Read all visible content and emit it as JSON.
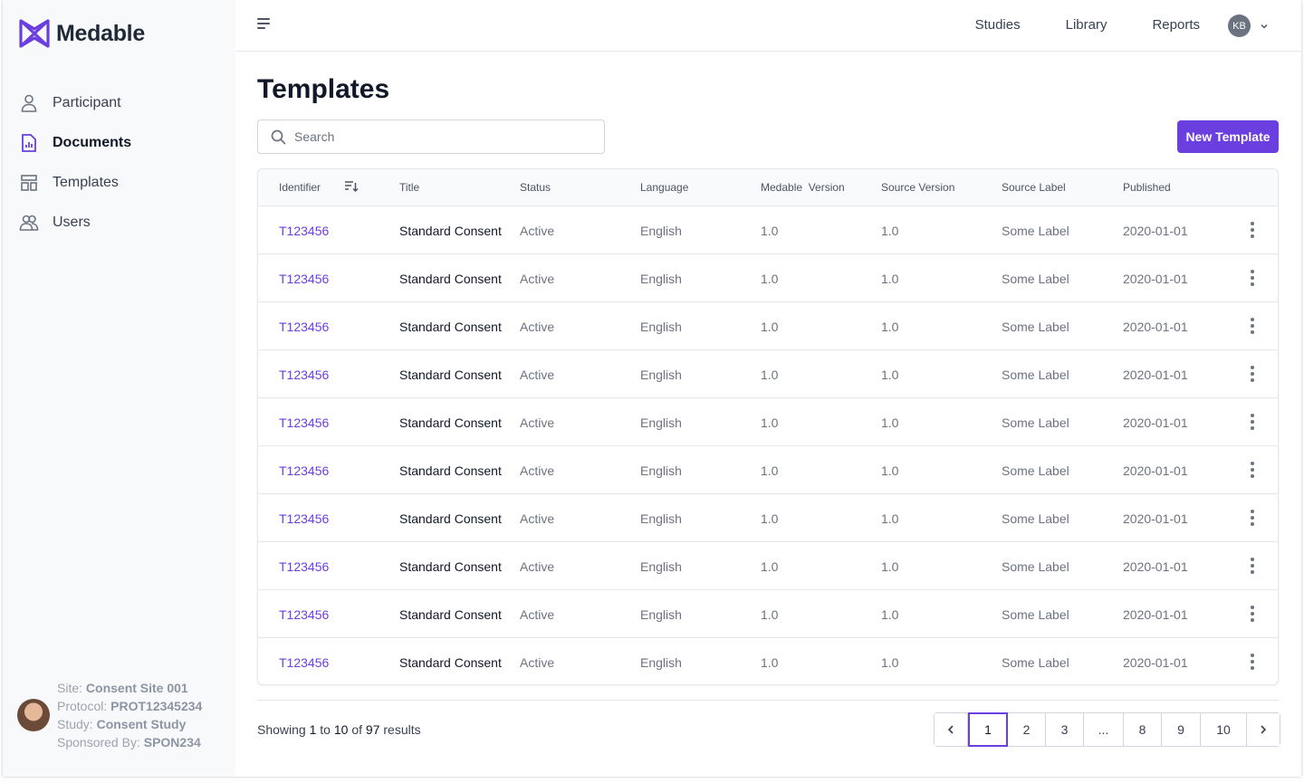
{
  "brand": {
    "name": "Medable",
    "accent": "#6b3ee0"
  },
  "sidebar": {
    "items": [
      {
        "label": "Participant",
        "icon": "person-icon"
      },
      {
        "label": "Documents",
        "icon": "document-chart-icon",
        "active": true
      },
      {
        "label": "Templates",
        "icon": "template-icon"
      },
      {
        "label": "Users",
        "icon": "users-icon"
      }
    ],
    "site": {
      "site_label": "Site:",
      "site_value": "Consent Site 001",
      "protocol_label": "Protocol:",
      "protocol_value": "PROT12345234",
      "study_label": "Study:",
      "study_value": "Consent Study",
      "sponsor_label": "Sponsored By:",
      "sponsor_value": "SPON234"
    }
  },
  "topbar": {
    "nav": [
      "Studies",
      "Library",
      "Reports"
    ],
    "user_initials": "KB"
  },
  "main": {
    "title": "Templates",
    "search_placeholder": "Search",
    "new_button": "New Template"
  },
  "table": {
    "columns": [
      "Identifier",
      "Title",
      "Status",
      "Language",
      "Medable  Version",
      "Source Version",
      "Source Label",
      "Published"
    ],
    "rows": [
      [
        "T123456",
        "Standard Consent",
        "Active",
        "English",
        "1.0",
        "1.0",
        "Some Label",
        "2020-01-01"
      ],
      [
        "T123456",
        "Standard Consent",
        "Active",
        "English",
        "1.0",
        "1.0",
        "Some Label",
        "2020-01-01"
      ],
      [
        "T123456",
        "Standard Consent",
        "Active",
        "English",
        "1.0",
        "1.0",
        "Some Label",
        "2020-01-01"
      ],
      [
        "T123456",
        "Standard Consent",
        "Active",
        "English",
        "1.0",
        "1.0",
        "Some Label",
        "2020-01-01"
      ],
      [
        "T123456",
        "Standard Consent",
        "Active",
        "English",
        "1.0",
        "1.0",
        "Some Label",
        "2020-01-01"
      ],
      [
        "T123456",
        "Standard Consent",
        "Active",
        "English",
        "1.0",
        "1.0",
        "Some Label",
        "2020-01-01"
      ],
      [
        "T123456",
        "Standard Consent",
        "Active",
        "English",
        "1.0",
        "1.0",
        "Some Label",
        "2020-01-01"
      ],
      [
        "T123456",
        "Standard Consent",
        "Active",
        "English",
        "1.0",
        "1.0",
        "Some Label",
        "2020-01-01"
      ],
      [
        "T123456",
        "Standard Consent",
        "Active",
        "English",
        "1.0",
        "1.0",
        "Some Label",
        "2020-01-01"
      ],
      [
        "T123456",
        "Standard Consent",
        "Active",
        "English",
        "1.0",
        "1.0",
        "Some Label",
        "2020-01-01"
      ]
    ]
  },
  "footer": {
    "showing": "Showing",
    "from": "1",
    "to_word": "to",
    "to": "10",
    "of_word": "of",
    "total": "97",
    "results_word": "results"
  },
  "pagination": {
    "pages": [
      "1",
      "2",
      "3",
      "...",
      "8",
      "9",
      "10"
    ],
    "current": "1"
  }
}
